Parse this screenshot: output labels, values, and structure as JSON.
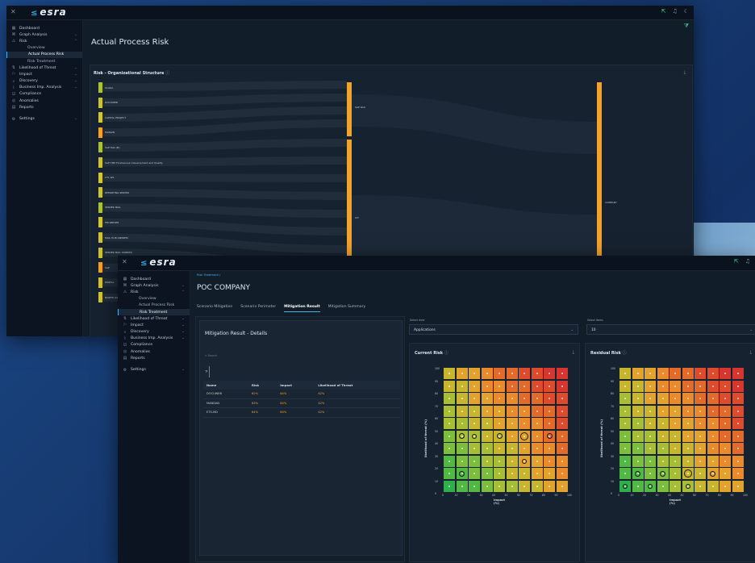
{
  "brand": "esra",
  "nav1": [
    {
      "icon": "▦",
      "label": "Dashboard",
      "name": "dashboard"
    },
    {
      "icon": "⌘",
      "label": "Graph Analysis",
      "name": "graph-analysis",
      "chev": "⌄"
    },
    {
      "icon": "⚠",
      "label": "Risk",
      "name": "risk",
      "chev": "⌃"
    },
    {
      "label": "Overview",
      "name": "overview",
      "sub": true
    },
    {
      "label": "Actual Process Risk",
      "name": "actual-process-risk",
      "sub": true,
      "active": true
    },
    {
      "label": "Risk Treatment",
      "name": "risk-treatment",
      "sub": true
    },
    {
      "icon": "⇅",
      "label": "Likelihood of Threat",
      "name": "likelihood-of-threat",
      "chev": "⌄"
    },
    {
      "icon": "⚐",
      "label": "Impact",
      "name": "impact",
      "chev": "⌄"
    },
    {
      "icon": "⌕",
      "label": "Discovery",
      "name": "discovery",
      "chev": "⌄"
    },
    {
      "icon": "⌇",
      "label": "Business Imp. Analysis",
      "name": "business-imp-analysis",
      "chev": "⌄"
    },
    {
      "icon": "☑",
      "label": "Compliance",
      "name": "compliance"
    },
    {
      "icon": "◎",
      "label": "Anomalies",
      "name": "anomalies"
    },
    {
      "icon": "▤",
      "label": "Reports",
      "name": "reports"
    },
    {
      "icon": "⚙",
      "label": "Settings",
      "name": "settings",
      "chev": "⌄",
      "gap": true
    }
  ],
  "nav2": [
    {
      "icon": "▦",
      "label": "Dashboard",
      "name": "dashboard"
    },
    {
      "icon": "⌘",
      "label": "Graph Analysis",
      "name": "graph-analysis",
      "chev": "⌄"
    },
    {
      "icon": "⚠",
      "label": "Risk",
      "name": "risk",
      "chev": "⌃"
    },
    {
      "label": "Overview",
      "name": "overview",
      "sub": true
    },
    {
      "label": "Actual Process Risk",
      "name": "actual-process-risk",
      "sub": true
    },
    {
      "label": "Risk Treatment",
      "name": "risk-treatment",
      "sub": true,
      "active": true
    },
    {
      "icon": "⇅",
      "label": "Likelihood of Threat",
      "name": "likelihood-of-threat",
      "chev": "⌄"
    },
    {
      "icon": "⚐",
      "label": "Impact",
      "name": "impact",
      "chev": "⌄"
    },
    {
      "icon": "⌕",
      "label": "Discovery",
      "name": "discovery",
      "chev": "⌄"
    },
    {
      "icon": "⌇",
      "label": "Business Imp. Analysis",
      "name": "business-imp-analysis",
      "chev": "⌄"
    },
    {
      "icon": "☑",
      "label": "Compliance",
      "name": "compliance"
    },
    {
      "icon": "◎",
      "label": "Anomalies",
      "name": "anomalies"
    },
    {
      "icon": "▤",
      "label": "Reports",
      "name": "reports"
    },
    {
      "icon": "⚙",
      "label": "Settings",
      "name": "settings",
      "chev": "⌄",
      "gap": true
    }
  ],
  "win1": {
    "title": "Actual Process Risk",
    "card_title": "Risk - Organizational Structure",
    "info_icon": "ⓘ",
    "download_icon": "⤓",
    "org_rows": [
      {
        "label": "SCADA",
        "color": "#a9c23a"
      },
      {
        "label": "DOCUWEB",
        "color": "#c9c23a"
      },
      {
        "label": "CAPITAL PROJECT",
        "color": "#d4c43a"
      },
      {
        "label": "MANAIN",
        "color": "#f2a32b"
      },
      {
        "label": "SAP Test (M)",
        "color": "#a9c23a"
      },
      {
        "label": "SAP TMP Forsheniuun Development and Quality",
        "color": "#c9c23a"
      },
      {
        "label": "CTL WS",
        "color": "#d4c43a"
      },
      {
        "label": "REPORTING SERVER",
        "color": "#c9c23a"
      },
      {
        "label": "SERVER MAIL",
        "color": "#a9c23a"
      },
      {
        "label": "FBI SERVER",
        "color": "#d4c43a"
      },
      {
        "label": "MAIL HUB ONPREM",
        "color": "#c9c23a"
      },
      {
        "label": "SERVER MAIL ONPREM",
        "color": "#c9c23a"
      },
      {
        "label": "SAP",
        "color": "#f2a32b"
      },
      {
        "label": "PORTAL",
        "color": "#d4c43a"
      },
      {
        "label": "NOZTIK S/I",
        "color": "#d4c43a"
      }
    ],
    "mid_labels": [
      "SAP RAU",
      "ICT"
    ],
    "right_label": "COMPANY"
  },
  "win2": {
    "breadcrumb": "Risk Treatment /",
    "title": "POC COMPANY",
    "tabs": [
      "Scenario Mitigation",
      "Scenario Perimeter",
      "Mitigation Result",
      "Mitigation Summary"
    ],
    "active_tab": 2,
    "details_title": "Mitigation Result - Details",
    "search_placeholder": "Search",
    "filter_icon": "⧩",
    "table": {
      "headers": [
        "Name",
        "Risk",
        "Impact",
        "Likelihood of Threat"
      ],
      "rows": [
        [
          "DOCUWEB",
          "62%",
          "64%",
          "42%"
        ],
        [
          "MANDAN",
          "63%",
          "64%",
          "42%"
        ],
        [
          "ETS-MD",
          "64%",
          "64%",
          "42%"
        ]
      ]
    },
    "select_level_label": "Select level",
    "select_level_value": "Applications",
    "select_items_label": "Select items",
    "select_items_value": "10",
    "current_title": "Current Risk",
    "residual_title": "Residual Risk",
    "ylabel": "likelihood of threat (%)",
    "xlabel": "Impact (%)",
    "yticks": [
      "100",
      "90",
      "80",
      "70",
      "60",
      "50",
      "40",
      "30",
      "20",
      "10",
      "0"
    ],
    "xticks": [
      "0",
      "10",
      "20",
      "30",
      "40",
      "50",
      "60",
      "70",
      "80",
      "90",
      "100"
    ],
    "colors": {
      "c0": "#2fae4c",
      "c1": "#52b844",
      "c2": "#7cbd3c",
      "c3": "#a6bd34",
      "c4": "#c8b52e",
      "c5": "#e2a22b",
      "c6": "#ea8a2a",
      "c7": "#e46a2a",
      "c8": "#dd4b2c",
      "c9": "#d6362e"
    },
    "current_markers": [
      [
        1,
        4,
        7
      ],
      [
        2,
        4,
        6
      ],
      [
        4,
        4,
        7
      ],
      [
        6,
        4,
        10
      ],
      [
        8,
        4,
        7
      ],
      [
        1,
        1,
        7
      ],
      [
        6,
        2,
        6
      ]
    ],
    "residual_markers": [
      [
        0,
        0,
        6
      ],
      [
        1,
        1,
        7
      ],
      [
        3,
        1,
        7
      ],
      [
        5,
        1,
        10
      ],
      [
        7,
        1,
        7
      ],
      [
        2,
        0,
        6
      ],
      [
        5,
        0,
        6
      ]
    ]
  }
}
